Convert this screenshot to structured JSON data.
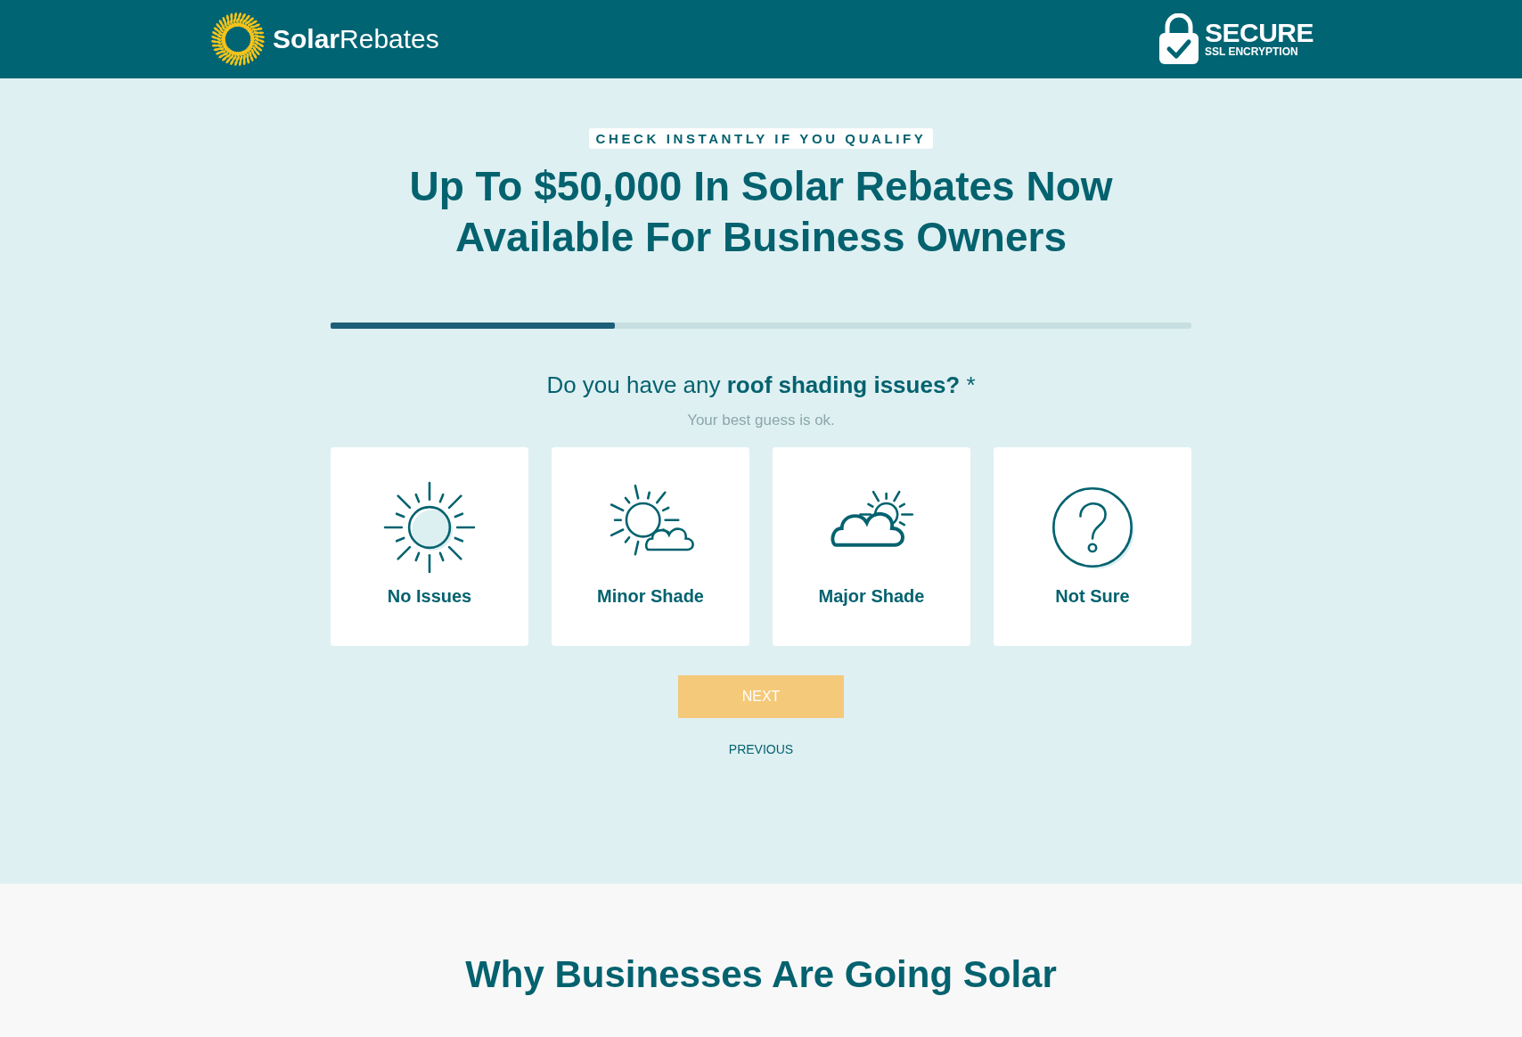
{
  "header": {
    "logo": "**Solar**Rebates",
    "secure_title": "SECURE",
    "secure_subtitle": "SSL ENCRYPTION"
  },
  "hero": {
    "eyebrow": "CHECK INSTANTLY IF YOU QUALIFY",
    "title": "Up To $50,000 In Solar Rebates Now Available For Business Owners"
  },
  "progress": {
    "level": 0.33
  },
  "question": {
    "text": "Do you have any **roof shading issues?** *",
    "hint": "Your best guess is ok."
  },
  "options": [
    {
      "label": "No Issues",
      "kind": "sun"
    },
    {
      "label": "Minor Shade",
      "kind": "sun-cloud"
    },
    {
      "label": "Major Shade",
      "kind": "cloud-sun"
    },
    {
      "label": "Not Sure",
      "kind": "question"
    }
  ],
  "next_button": {
    "label": "NEXT",
    "disabled": true
  },
  "previous_link": "PREVIOUS",
  "section": {
    "title": "Why Businesses Are Going Solar"
  }
}
